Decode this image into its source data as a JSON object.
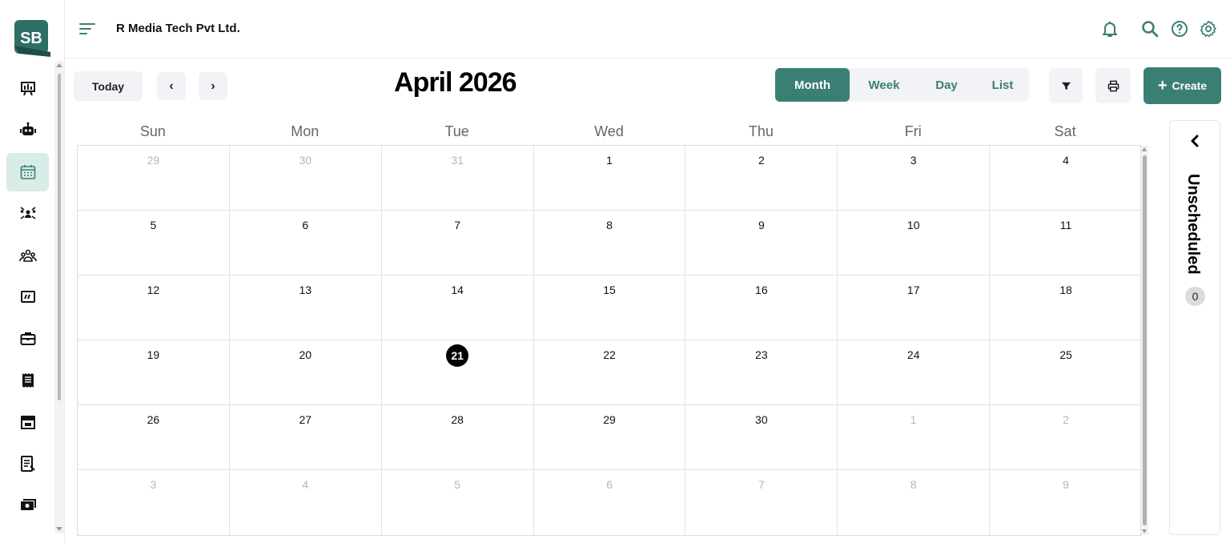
{
  "app": {
    "logo_text": "SB",
    "company": "R Media Tech Pvt Ltd.",
    "accent": "#3a7f74"
  },
  "sidebar": {
    "items": [
      {
        "name": "presentation-icon",
        "active": false
      },
      {
        "name": "robot-icon",
        "active": false
      },
      {
        "name": "calendar-icon",
        "active": true
      },
      {
        "name": "team-connect-icon",
        "active": false
      },
      {
        "name": "people-group-icon",
        "active": false
      },
      {
        "name": "quote-board-icon",
        "active": false
      },
      {
        "name": "briefcase-icon",
        "active": false
      },
      {
        "name": "receipt-icon",
        "active": false
      },
      {
        "name": "store-icon",
        "active": false
      },
      {
        "name": "document-icon",
        "active": false
      },
      {
        "name": "money-icon",
        "active": false
      }
    ]
  },
  "header": {
    "icons": [
      "bell-icon",
      "search-icon",
      "help-icon",
      "settings-icon"
    ]
  },
  "toolbar": {
    "today": "Today",
    "prev": "‹",
    "next": "›",
    "title": "April 2026",
    "views": [
      "Month",
      "Week",
      "Day",
      "List"
    ],
    "active_view": "Month",
    "create": "Create"
  },
  "calendar": {
    "weekdays": [
      "Sun",
      "Mon",
      "Tue",
      "Wed",
      "Thu",
      "Fri",
      "Sat"
    ],
    "weeks": [
      [
        {
          "d": "29",
          "o": true
        },
        {
          "d": "30",
          "o": true
        },
        {
          "d": "31",
          "o": true
        },
        {
          "d": "1"
        },
        {
          "d": "2"
        },
        {
          "d": "3"
        },
        {
          "d": "4"
        }
      ],
      [
        {
          "d": "5"
        },
        {
          "d": "6"
        },
        {
          "d": "7"
        },
        {
          "d": "8"
        },
        {
          "d": "9"
        },
        {
          "d": "10"
        },
        {
          "d": "11"
        }
      ],
      [
        {
          "d": "12"
        },
        {
          "d": "13"
        },
        {
          "d": "14"
        },
        {
          "d": "15"
        },
        {
          "d": "16"
        },
        {
          "d": "17"
        },
        {
          "d": "18"
        }
      ],
      [
        {
          "d": "19"
        },
        {
          "d": "20"
        },
        {
          "d": "21",
          "today": true
        },
        {
          "d": "22"
        },
        {
          "d": "23"
        },
        {
          "d": "24"
        },
        {
          "d": "25"
        }
      ],
      [
        {
          "d": "26"
        },
        {
          "d": "27"
        },
        {
          "d": "28"
        },
        {
          "d": "29"
        },
        {
          "d": "30"
        },
        {
          "d": "1",
          "o": true
        },
        {
          "d": "2",
          "o": true
        }
      ],
      [
        {
          "d": "3",
          "o": true
        },
        {
          "d": "4",
          "o": true
        },
        {
          "d": "5",
          "o": true
        },
        {
          "d": "6",
          "o": true
        },
        {
          "d": "7",
          "o": true
        },
        {
          "d": "8",
          "o": true
        },
        {
          "d": "9",
          "o": true
        }
      ]
    ]
  },
  "unscheduled": {
    "label": "Unscheduled",
    "count": "0"
  }
}
